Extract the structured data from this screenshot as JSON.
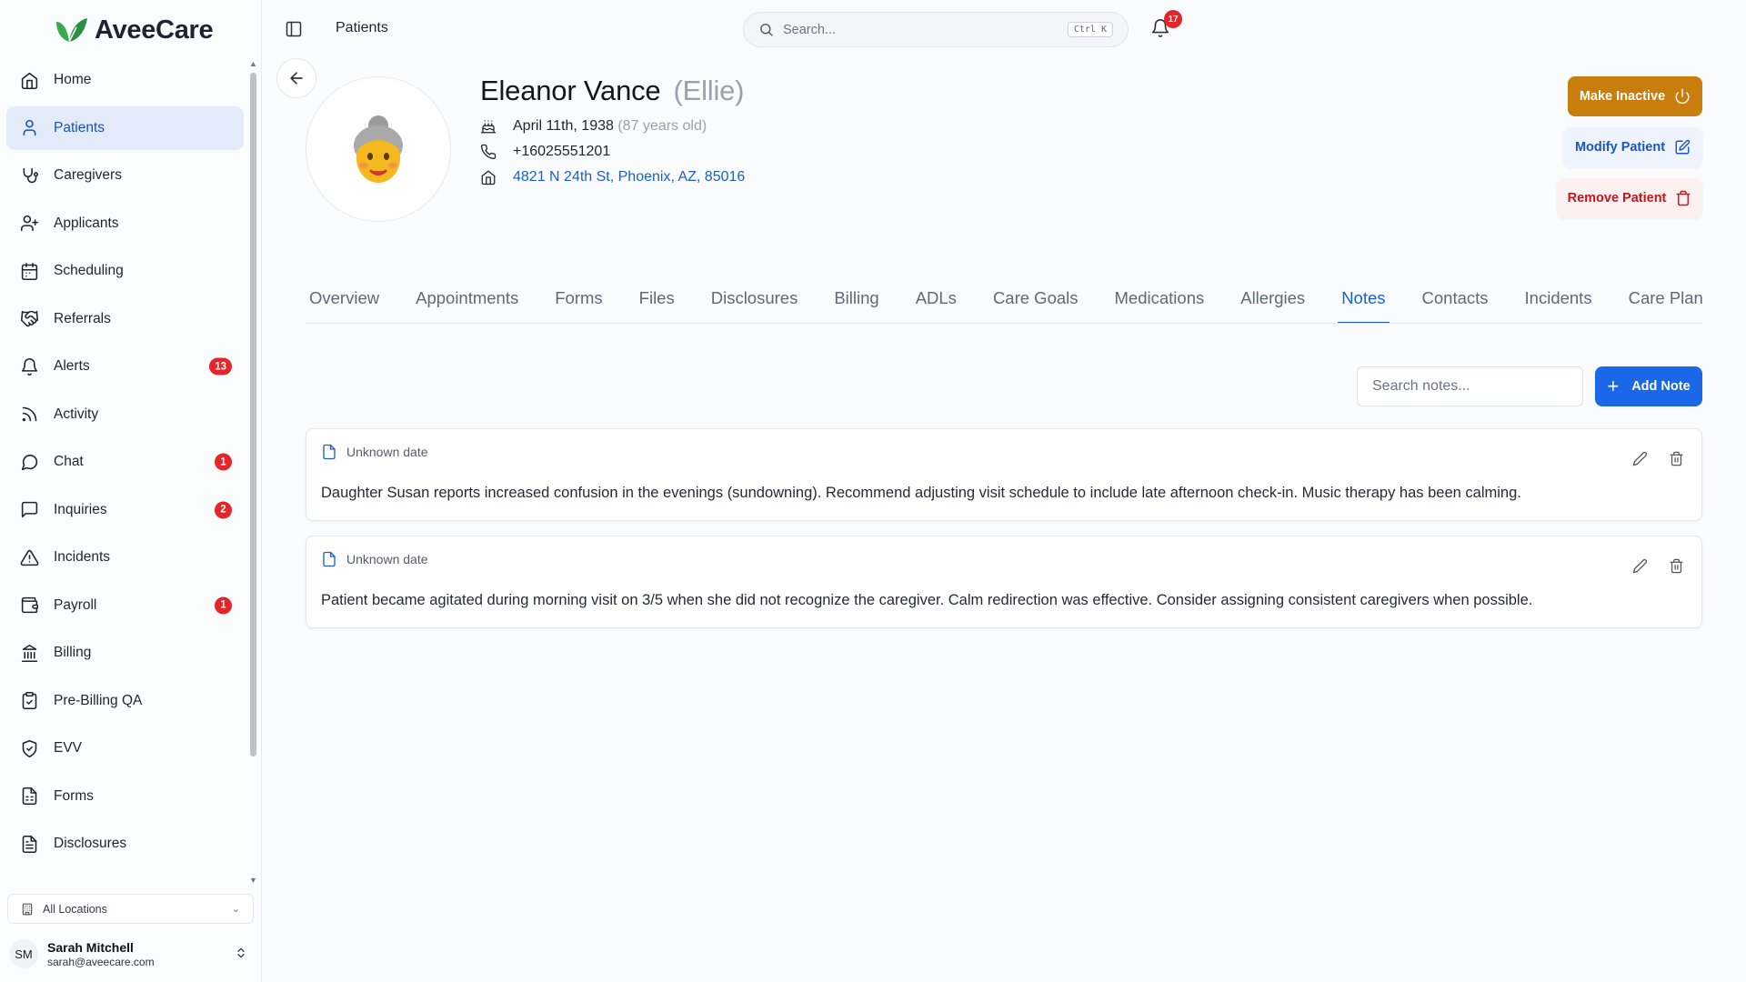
{
  "brand": {
    "name": "AveeCare",
    "accent": "#1a5fd0",
    "logo_green": "#2ea84a"
  },
  "sidebar": {
    "items": [
      {
        "label": "Home",
        "icon": "home-icon"
      },
      {
        "label": "Patients",
        "icon": "user-icon",
        "active": true
      },
      {
        "label": "Caregivers",
        "icon": "stethoscope-icon"
      },
      {
        "label": "Applicants",
        "icon": "user-plus-icon"
      },
      {
        "label": "Scheduling",
        "icon": "calendar-icon"
      },
      {
        "label": "Referrals",
        "icon": "handshake-icon"
      },
      {
        "label": "Alerts",
        "icon": "bell-icon",
        "badge": "13"
      },
      {
        "label": "Activity",
        "icon": "rss-icon"
      },
      {
        "label": "Chat",
        "icon": "message-circle-icon",
        "badge": "1"
      },
      {
        "label": "Inquiries",
        "icon": "message-square-icon",
        "badge": "2"
      },
      {
        "label": "Incidents",
        "icon": "alert-triangle-icon"
      },
      {
        "label": "Payroll",
        "icon": "wallet-icon",
        "badge": "1"
      },
      {
        "label": "Billing",
        "icon": "landmark-icon"
      },
      {
        "label": "Pre-Billing QA",
        "icon": "clipboard-check-icon"
      },
      {
        "label": "EVV",
        "icon": "shield-check-icon"
      },
      {
        "label": "Forms",
        "icon": "file-form-icon"
      },
      {
        "label": "Disclosures",
        "icon": "file-text-icon"
      }
    ],
    "location_select": "All Locations",
    "user": {
      "initials": "SM",
      "name": "Sarah Mitchell",
      "email": "sarah@aveecare.com"
    }
  },
  "header": {
    "breadcrumb": "Patients",
    "search_placeholder": "Search...",
    "search_shortcut": "Ctrl K",
    "notifications_count": "17"
  },
  "patient": {
    "name": "Eleanor Vance",
    "nickname": "(Ellie)",
    "dob": "April 11th, 1938",
    "age": "(87 years old)",
    "phone": "+16025551201",
    "address": "4821 N 24th St, Phoenix, AZ, 85016",
    "avatar_emoji": "👵"
  },
  "actions": {
    "make_inactive": "Make Inactive",
    "modify": "Modify Patient",
    "remove": "Remove Patient"
  },
  "tabs": [
    "Overview",
    "Appointments",
    "Forms",
    "Files",
    "Disclosures",
    "Billing",
    "ADLs",
    "Care Goals",
    "Medications",
    "Allergies",
    "Notes",
    "Contacts",
    "Incidents",
    "Care Plans"
  ],
  "active_tab": "Notes",
  "notes_toolbar": {
    "search_placeholder": "Search notes...",
    "add_label": "Add Note"
  },
  "notes": [
    {
      "date": "Unknown date",
      "text": "Daughter Susan reports increased confusion in the evenings (sundowning). Recommend adjusting visit schedule to include late afternoon check-in. Music therapy has been calming."
    },
    {
      "date": "Unknown date",
      "text": "Patient became agitated during morning visit on 3/5 when she did not recognize the caregiver. Calm redirection was effective. Consider assigning consistent caregivers when possible."
    }
  ]
}
